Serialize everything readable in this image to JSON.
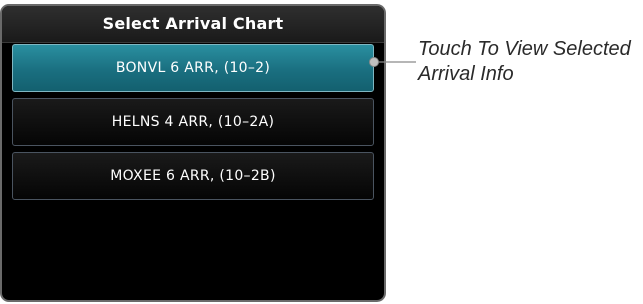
{
  "dialog": {
    "title": "Select Arrival Chart",
    "items": [
      {
        "label": "BONVL 6 ARR, (10–2)",
        "selected": true
      },
      {
        "label": "HELNS 4 ARR, (10–2A)",
        "selected": false
      },
      {
        "label": "MOXEE 6 ARR, (10–2B)",
        "selected": false
      }
    ]
  },
  "annotation": {
    "line1": "Touch To View Selected",
    "line2": "Arrival Info"
  },
  "colors": {
    "selected_item": "#1f7f90",
    "panel_background": "#000000",
    "panel_border": "#6a6a6a"
  }
}
